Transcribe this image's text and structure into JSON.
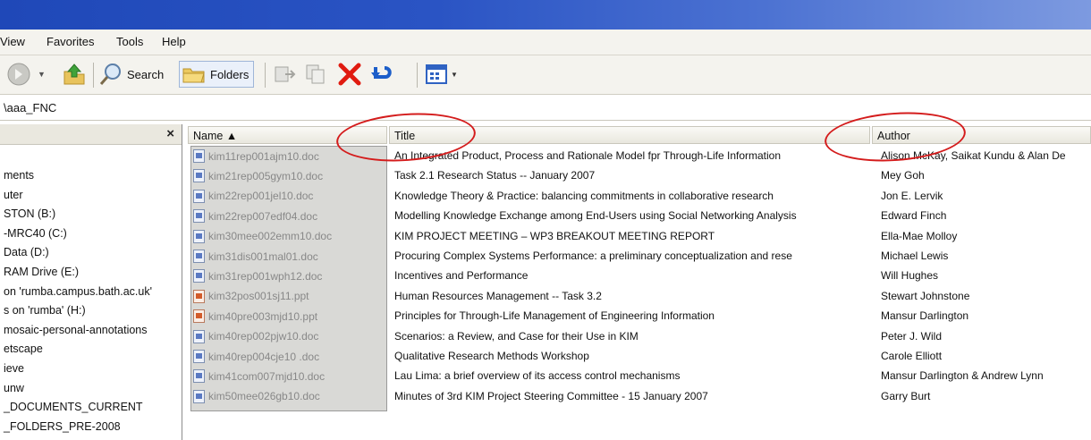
{
  "menu": [
    "View",
    "Favorites",
    "Tools",
    "Help"
  ],
  "toolbar": {
    "search_label": "Search",
    "folders_label": "Folders"
  },
  "address": {
    "path": "\\aaa_FNC"
  },
  "folder_pane": {
    "close_label": "×",
    "items": [
      "ments",
      "uter",
      "STON (B:)",
      "-MRC40 (C:)",
      "Data (D:)",
      "RAM Drive (E:)",
      "on 'rumba.campus.bath.ac.uk'",
      "s on 'rumba' (H:)",
      "mosaic-personal-annotations",
      "etscape",
      "ieve",
      "unw",
      "_DOCUMENTS_CURRENT",
      "_FOLDERS_PRE-2008"
    ]
  },
  "columns": {
    "name": "Name  ▲",
    "title": "Title",
    "author": "Author"
  },
  "files": [
    {
      "name": "kim11rep001ajm10.doc",
      "type": "doc",
      "title": "An Integrated Product, Process and Rationale Model fpr Through-Life Information",
      "author": "Alison McKay, Saikat Kundu & Alan De"
    },
    {
      "name": "kim21rep005gym10.doc",
      "type": "doc",
      "title": "Task 2.1 Research Status -- January 2007",
      "author": "Mey Goh"
    },
    {
      "name": "kim22rep001jel10.doc",
      "type": "doc",
      "title": "Knowledge Theory & Practice: balancing commitments in collaborative research",
      "author": "Jon E. Lervik"
    },
    {
      "name": "kim22rep007edf04.doc",
      "type": "doc",
      "title": "Modelling Knowledge Exchange among End-Users using Social Networking Analysis",
      "author": "Edward Finch"
    },
    {
      "name": "kim30mee002emm10.doc",
      "type": "doc",
      "title": "KIM PROJECT MEETING – WP3 BREAKOUT MEETING REPORT",
      "author": "Ella-Mae Molloy"
    },
    {
      "name": "kim31dis001mal01.doc",
      "type": "doc",
      "title": "Procuring Complex Systems Performance: a preliminary conceptualization and rese",
      "author": "Michael Lewis"
    },
    {
      "name": "kim31rep001wph12.doc",
      "type": "doc",
      "title": "Incentives and Performance",
      "author": "Will Hughes"
    },
    {
      "name": "kim32pos001sj11.ppt",
      "type": "ppt",
      "title": " Human Resources Management -- Task 3.2",
      "author": "Stewart Johnstone"
    },
    {
      "name": "kim40pre003mjd10.ppt",
      "type": "ppt",
      "title": "Principles for Through-Life Management of Engineering Information",
      "author": "Mansur Darlington"
    },
    {
      "name": "kim40rep002pjw10.doc",
      "type": "doc",
      "title": "Scenarios: a Review, and Case for their Use in KIM",
      "author": "Peter J. Wild"
    },
    {
      "name": "kim40rep004cje10 .doc",
      "type": "doc",
      "title": "Qualitative Research Methods Workshop",
      "author": "Carole Elliott"
    },
    {
      "name": "kim41com007mjd10.doc",
      "type": "doc",
      "title": "Lau Lima: a brief overview of its access control mechanisms",
      "author": "Mansur Darlington & Andrew Lynn"
    },
    {
      "name": "kim50mee026gb10.doc",
      "type": "doc",
      "title": "Minutes of 3rd KIM Project Steering Committee - 15 January 2007",
      "author": "Garry Burt"
    }
  ],
  "colors": {
    "annotation_red": "#d41c1c",
    "titlebar_blue": "#2a54c4"
  }
}
